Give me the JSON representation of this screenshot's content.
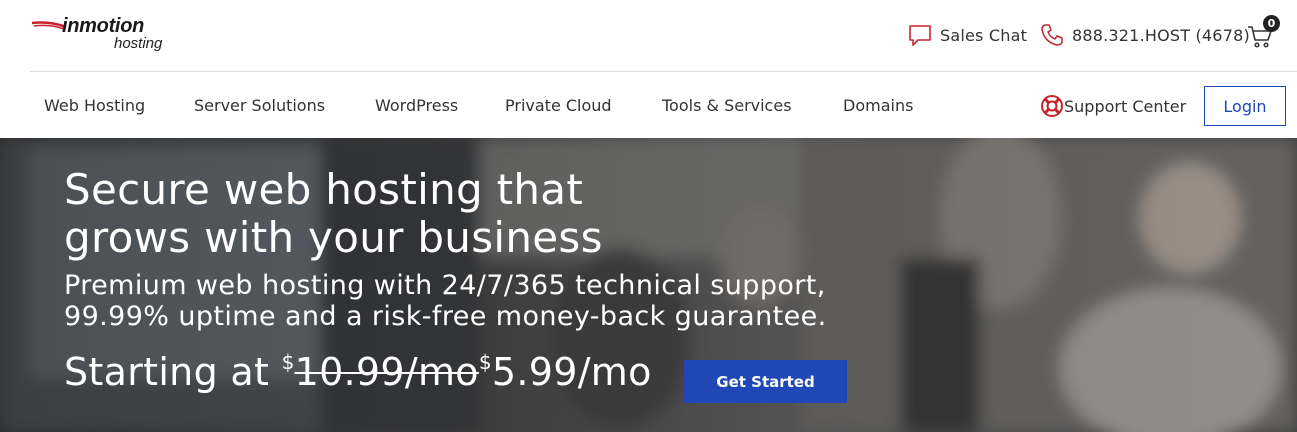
{
  "brand": {
    "main": "inmotion",
    "sub": "hosting"
  },
  "header": {
    "sales_chat": "Sales Chat",
    "phone": "888.321.HOST (4678)",
    "cart_count": "0"
  },
  "nav": {
    "items": [
      {
        "label": "Web Hosting"
      },
      {
        "label": "Server Solutions"
      },
      {
        "label": "WordPress"
      },
      {
        "label": "Private Cloud"
      },
      {
        "label": "Tools & Services"
      },
      {
        "label": "Domains"
      }
    ],
    "support_center": "Support Center",
    "login": "Login"
  },
  "hero": {
    "title": "Secure web hosting that grows with your business",
    "subtitle": "Premium web hosting with 24/7/365 technical support, 99.99% uptime and a risk-free money-back guarantee.",
    "price_prefix": "Starting at",
    "currency": "$",
    "old_price": "10.99/mo",
    "new_price": "5.99/mo",
    "cta": "Get Started"
  },
  "colors": {
    "accent_blue": "#1f47b5",
    "icon_red": "#c8232c"
  },
  "icons": [
    "chat-bubble-icon",
    "phone-icon",
    "cart-icon",
    "lifebuoy-icon"
  ]
}
